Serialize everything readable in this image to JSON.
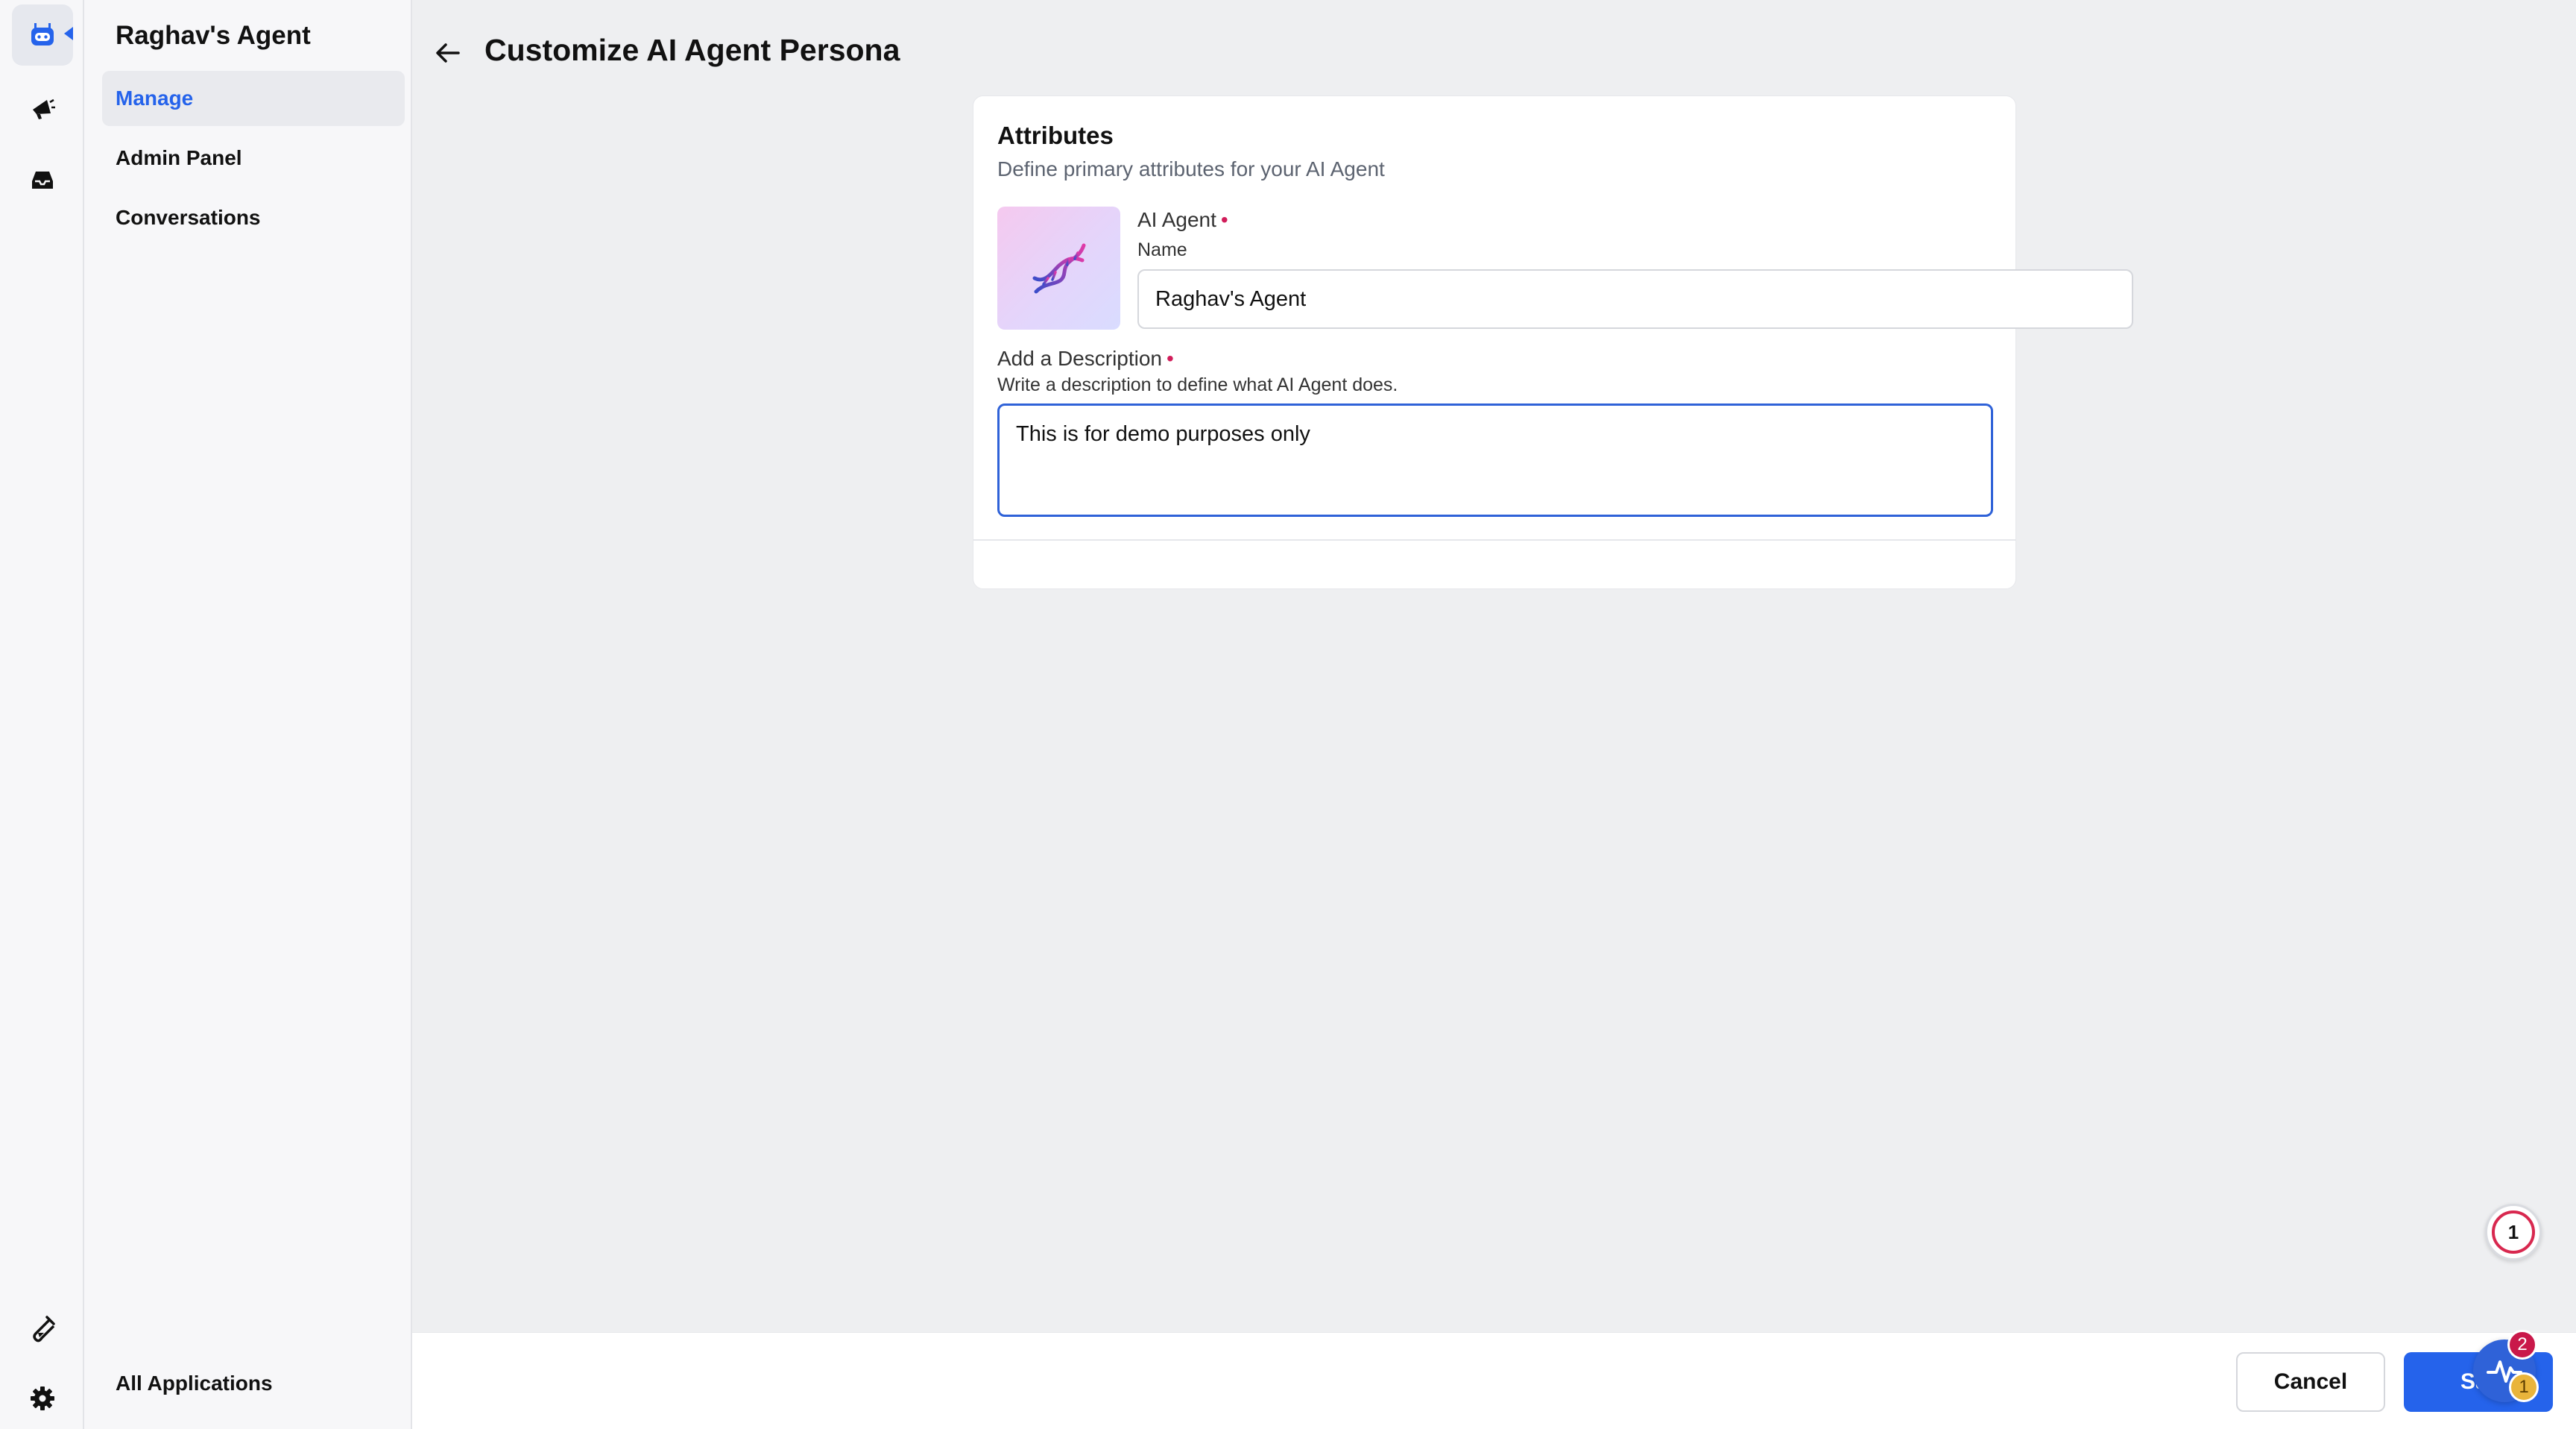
{
  "rail": {
    "icons": [
      "robot-icon",
      "megaphone-icon",
      "inbox-icon",
      "test-tube-icon",
      "gear-icon"
    ]
  },
  "sidebar": {
    "title": "Raghav's Agent",
    "items": [
      {
        "label": "Manage",
        "active": true
      },
      {
        "label": "Admin Panel",
        "active": false
      },
      {
        "label": "Conversations",
        "active": false
      }
    ],
    "footer_label": "All Applications"
  },
  "header": {
    "title": "Customize AI Agent Persona"
  },
  "attributes": {
    "title": "Attributes",
    "subtitle": "Define primary attributes for your AI Agent",
    "agent_label": "AI Agent",
    "name_label": "Name",
    "name_value": "Raghav's Agent",
    "description_label": "Add a Description",
    "description_help": "Write a description to define what AI Agent does.",
    "description_value": "This is for demo purposes only"
  },
  "footer": {
    "cancel_label": "Cancel",
    "save_label": "Sa"
  },
  "floating": {
    "counter_value": "1",
    "notif_red": "2",
    "notif_yellow": "1"
  },
  "colors": {
    "accent": "#2563eb",
    "required": "#d11d5a"
  }
}
